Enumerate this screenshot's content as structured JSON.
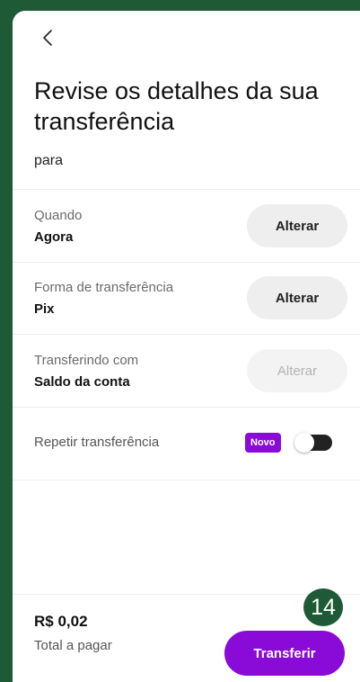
{
  "header": {
    "title": "Revise os detalhes da sua transferência",
    "subtitle": "para"
  },
  "details": [
    {
      "label": "Quando",
      "value": "Agora",
      "action": "Alterar",
      "enabled": true
    },
    {
      "label": "Forma de transferência",
      "value": "Pix",
      "action": "Alterar",
      "enabled": true
    },
    {
      "label": "Transferindo com",
      "value": "Saldo da conta",
      "action": "Alterar",
      "enabled": false
    }
  ],
  "repeat": {
    "label": "Repetir transferência",
    "badge": "Novo",
    "toggle_on": false
  },
  "footer": {
    "amount": "R$ 0,02",
    "amount_label": "Total a pagar",
    "submit_label": "Transferir"
  },
  "step_badge": "14",
  "colors": {
    "accent": "#8a0ad8",
    "frame": "#1f5a37"
  },
  "icons": {
    "back": "chevron-left-icon"
  }
}
